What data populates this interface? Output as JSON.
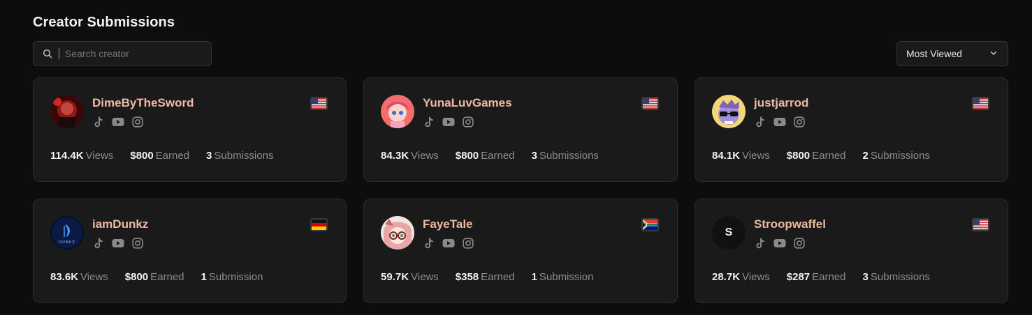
{
  "header": {
    "title": "Creator Submissions"
  },
  "search": {
    "placeholder": "Search creator",
    "icon": "search-icon"
  },
  "sort": {
    "selected": "Most Viewed",
    "icon": "chevron-down-icon"
  },
  "colors": {
    "accent_name": "#f0b9a3",
    "card_bg": "#1a1a1a",
    "page_bg": "#0d0d0d"
  },
  "labels": {
    "views": "Views",
    "earned": "Earned"
  },
  "creators": [
    {
      "name": "DimeByTheSword",
      "flag": "US",
      "views": "114.4K",
      "earned": "$800",
      "submissions": "3",
      "submissions_label": "Submissions",
      "avatar": "red-portrait"
    },
    {
      "name": "YunaLuvGames",
      "flag": "US",
      "views": "84.3K",
      "earned": "$800",
      "submissions": "3",
      "submissions_label": "Submissions",
      "avatar": "pink-anime"
    },
    {
      "name": "justjarrod",
      "flag": "US",
      "views": "84.1K",
      "earned": "$800",
      "submissions": "2",
      "submissions_label": "Submissions",
      "avatar": "purple-sunglasses"
    },
    {
      "name": "iamDunkz",
      "flag": "DE",
      "views": "83.6K",
      "earned": "$800",
      "submissions": "1",
      "submissions_label": "Submission",
      "avatar": "dunkz-logo",
      "avatar_text": "DUNKZ"
    },
    {
      "name": "FayeTale",
      "flag": "ZA",
      "views": "59.7K",
      "earned": "$358",
      "submissions": "1",
      "submissions_label": "Submission",
      "avatar": "pink-hair-glasses"
    },
    {
      "name": "Stroopwaffel",
      "flag": "US",
      "views": "28.7K",
      "earned": "$287",
      "submissions": "3",
      "submissions_label": "Submissions",
      "avatar": "initial",
      "avatar_initial": "S"
    }
  ]
}
